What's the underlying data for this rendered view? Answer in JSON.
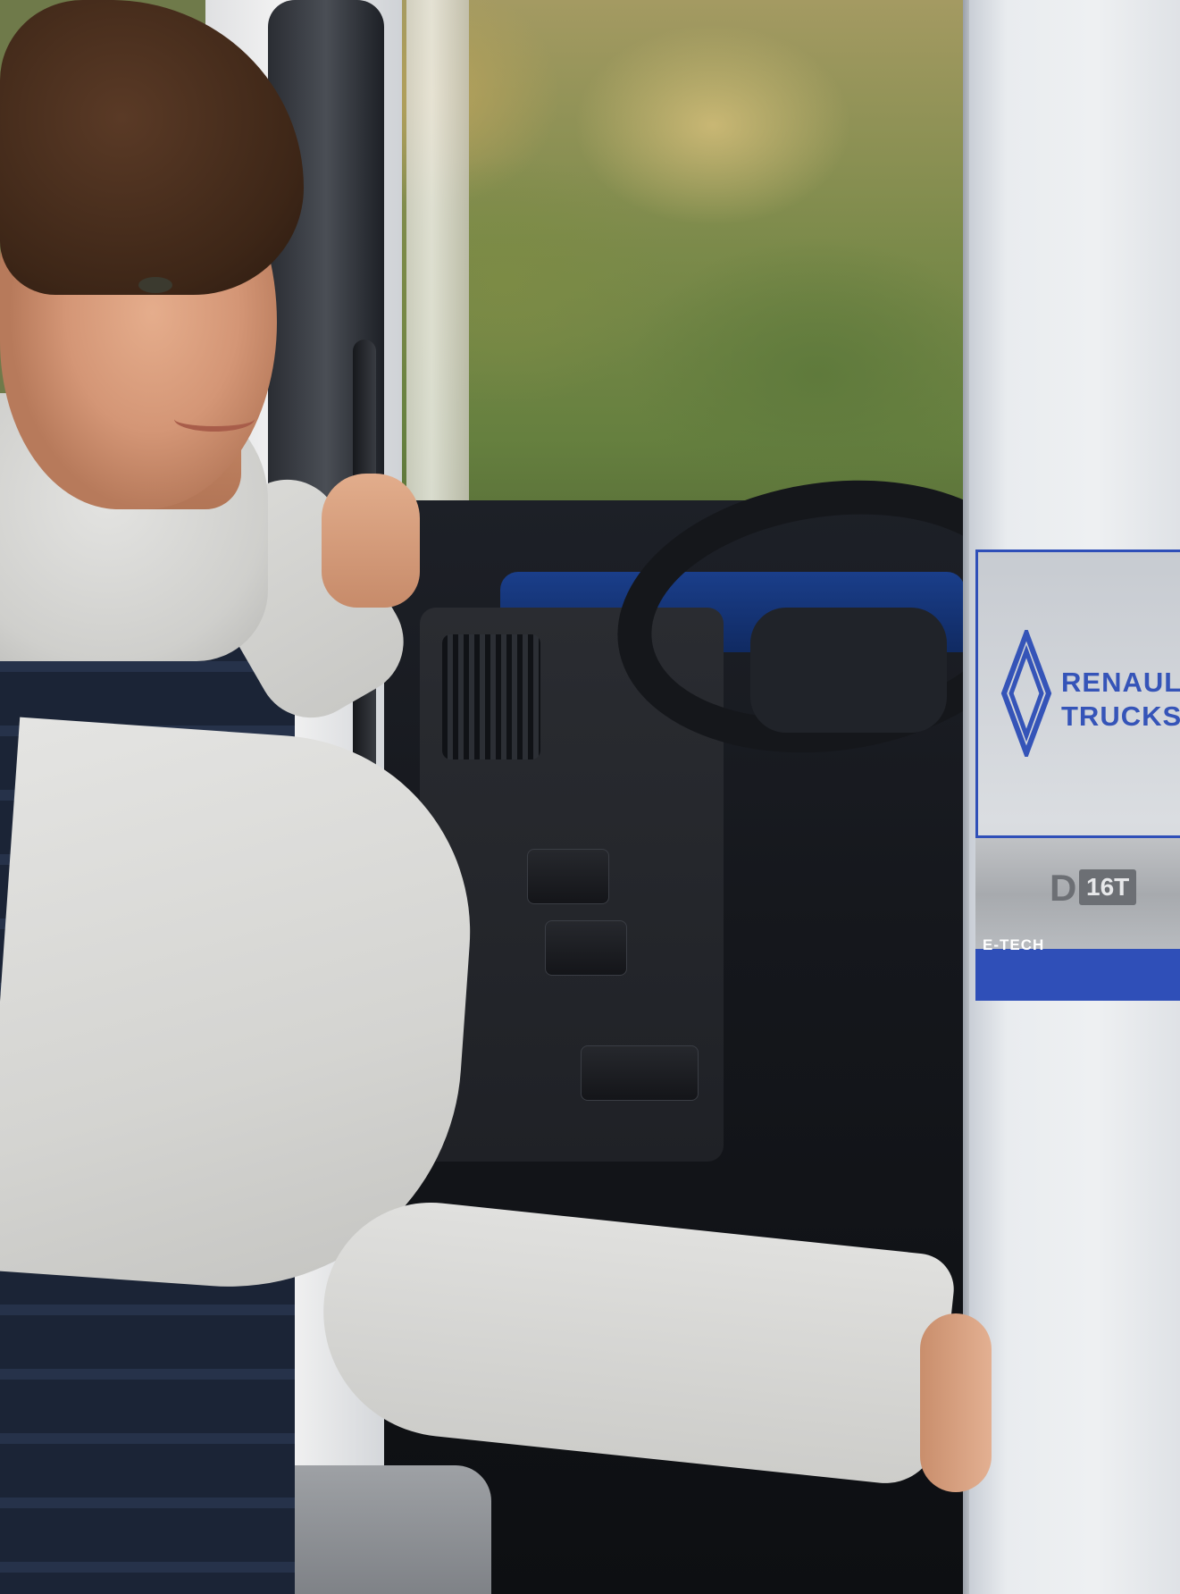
{
  "badge": {
    "brand_line1": "RENAULT",
    "brand_line2": "TRUCKS",
    "model_letter": "D",
    "weight": "16T",
    "powertrain": "E-TECH"
  },
  "colors": {
    "brand_blue": "#2f4fb8",
    "vest_navy": "#1b2436",
    "sweater_grey": "#d4d4d1",
    "door_white": "#eef0f2"
  }
}
